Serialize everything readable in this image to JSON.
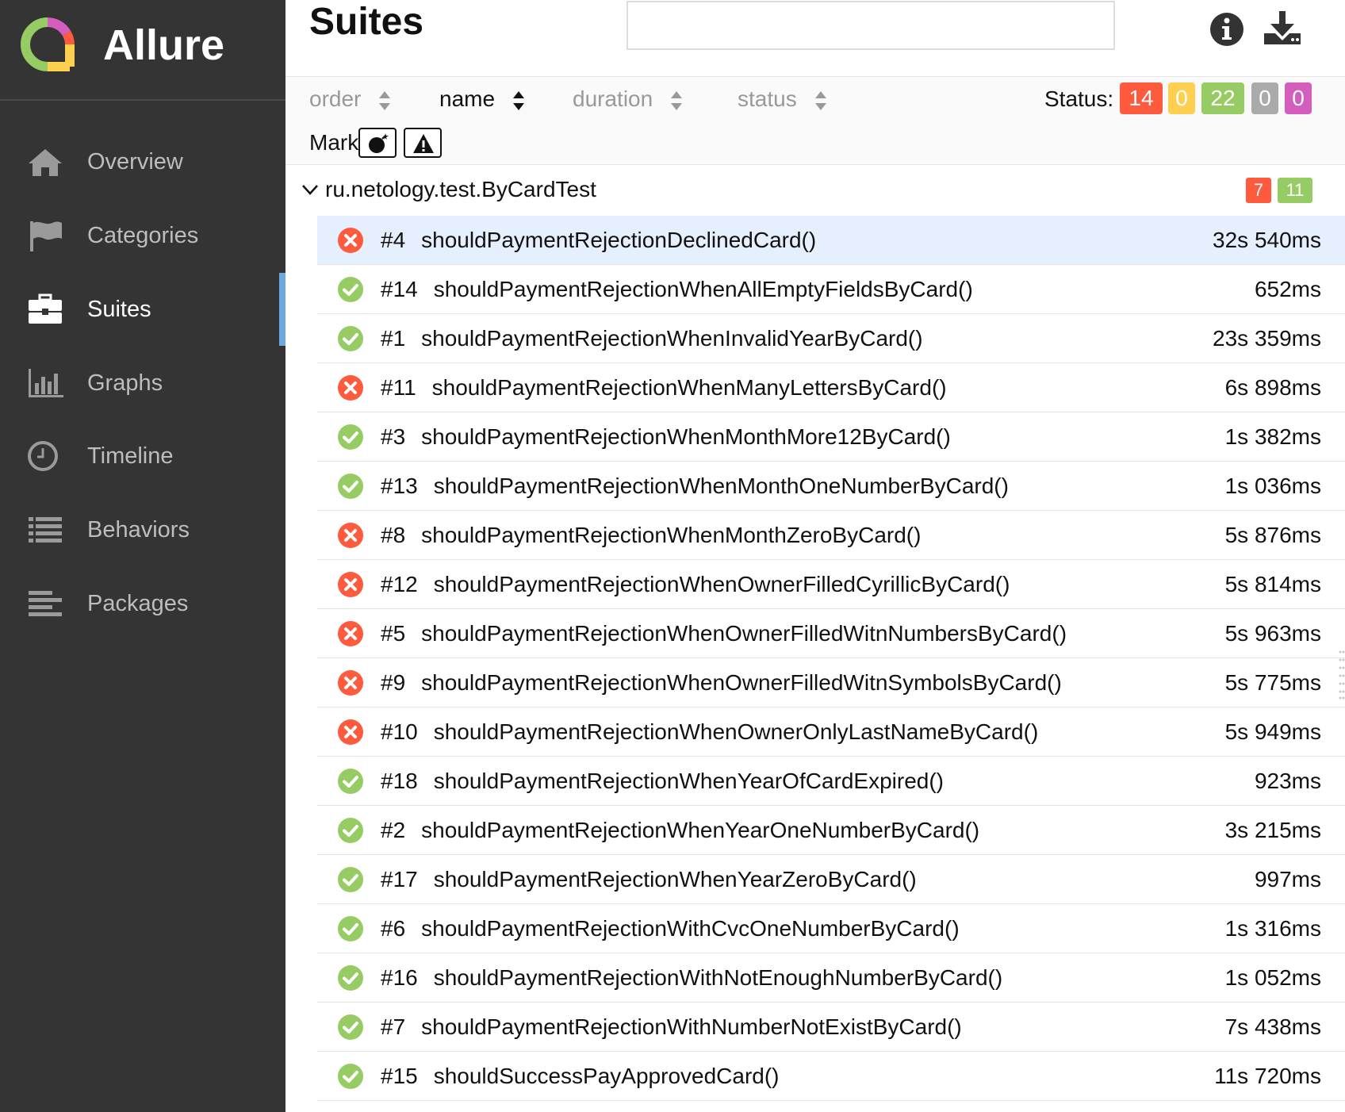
{
  "brand": {
    "name": "Allure"
  },
  "sidebar": {
    "items": [
      {
        "label": "Overview",
        "icon": "home-icon"
      },
      {
        "label": "Categories",
        "icon": "flag-icon"
      },
      {
        "label": "Suites",
        "icon": "briefcase-icon"
      },
      {
        "label": "Graphs",
        "icon": "bar-chart-icon"
      },
      {
        "label": "Timeline",
        "icon": "clock-icon"
      },
      {
        "label": "Behaviors",
        "icon": "list-icon"
      },
      {
        "label": "Packages",
        "icon": "align-left-icon"
      }
    ],
    "active": "Suites",
    "accent": "#6fa8dc"
  },
  "header": {
    "title": "Suites",
    "search_value": "",
    "info_icon": "info-icon",
    "download_icon": "download-icon"
  },
  "toolbar": {
    "sort": {
      "order": "order",
      "name": "name",
      "duration": "duration",
      "status": "status"
    },
    "status_label": "Status:",
    "status_counts": {
      "failed": "14",
      "broken": "0",
      "passed": "22",
      "skipped": "0",
      "unknown": "0"
    },
    "marks_label": "Marks:",
    "marks": [
      "flaky-bomb-icon",
      "warning-icon"
    ]
  },
  "colors": {
    "failed": "#fd5a3e",
    "broken": "#ffd050",
    "passed": "#97cc64",
    "skipped": "#aaaaaa",
    "unknown": "#d35ebe",
    "selected_row": "#e6effd"
  },
  "group": {
    "name": "ru.netology.test.ByCardTest",
    "failed": "7",
    "passed": "11"
  },
  "tests": [
    {
      "num": "#4",
      "name": "shouldPaymentRejectionDeclinedCard()",
      "duration": "32s 540ms",
      "status": "failed"
    },
    {
      "num": "#14",
      "name": "shouldPaymentRejectionWhenAllEmptyFieldsByCard()",
      "duration": "652ms",
      "status": "passed"
    },
    {
      "num": "#1",
      "name": "shouldPaymentRejectionWhenInvalidYearByCard()",
      "duration": "23s 359ms",
      "status": "passed"
    },
    {
      "num": "#11",
      "name": "shouldPaymentRejectionWhenManyLettersByCard()",
      "duration": "6s 898ms",
      "status": "failed"
    },
    {
      "num": "#3",
      "name": "shouldPaymentRejectionWhenMonthMore12ByCard()",
      "duration": "1s 382ms",
      "status": "passed"
    },
    {
      "num": "#13",
      "name": "shouldPaymentRejectionWhenMonthOneNumberByCard()",
      "duration": "1s 036ms",
      "status": "passed"
    },
    {
      "num": "#8",
      "name": "shouldPaymentRejectionWhenMonthZeroByCard()",
      "duration": "5s 876ms",
      "status": "failed"
    },
    {
      "num": "#12",
      "name": "shouldPaymentRejectionWhenOwnerFilledCyrillicByCard()",
      "duration": "5s 814ms",
      "status": "failed"
    },
    {
      "num": "#5",
      "name": "shouldPaymentRejectionWhenOwnerFilledWitnNumbersByCard()",
      "duration": "5s 963ms",
      "status": "failed"
    },
    {
      "num": "#9",
      "name": "shouldPaymentRejectionWhenOwnerFilledWitnSymbolsByCard()",
      "duration": "5s 775ms",
      "status": "failed"
    },
    {
      "num": "#10",
      "name": "shouldPaymentRejectionWhenOwnerOnlyLastNameByCard()",
      "duration": "5s 949ms",
      "status": "failed"
    },
    {
      "num": "#18",
      "name": "shouldPaymentRejectionWhenYearOfCardExpired()",
      "duration": "923ms",
      "status": "passed"
    },
    {
      "num": "#2",
      "name": "shouldPaymentRejectionWhenYearOneNumberByCard()",
      "duration": "3s 215ms",
      "status": "passed"
    },
    {
      "num": "#17",
      "name": "shouldPaymentRejectionWhenYearZeroByCard()",
      "duration": "997ms",
      "status": "passed"
    },
    {
      "num": "#6",
      "name": "shouldPaymentRejectionWithCvcOneNumberByCard()",
      "duration": "1s 316ms",
      "status": "passed"
    },
    {
      "num": "#16",
      "name": "shouldPaymentRejectionWithNotEnoughNumberByCard()",
      "duration": "1s 052ms",
      "status": "passed"
    },
    {
      "num": "#7",
      "name": "shouldPaymentRejectionWithNumberNotExistByCard()",
      "duration": "7s 438ms",
      "status": "passed"
    },
    {
      "num": "#15",
      "name": "shouldSuccessPayApprovedCard()",
      "duration": "11s 720ms",
      "status": "passed"
    }
  ]
}
